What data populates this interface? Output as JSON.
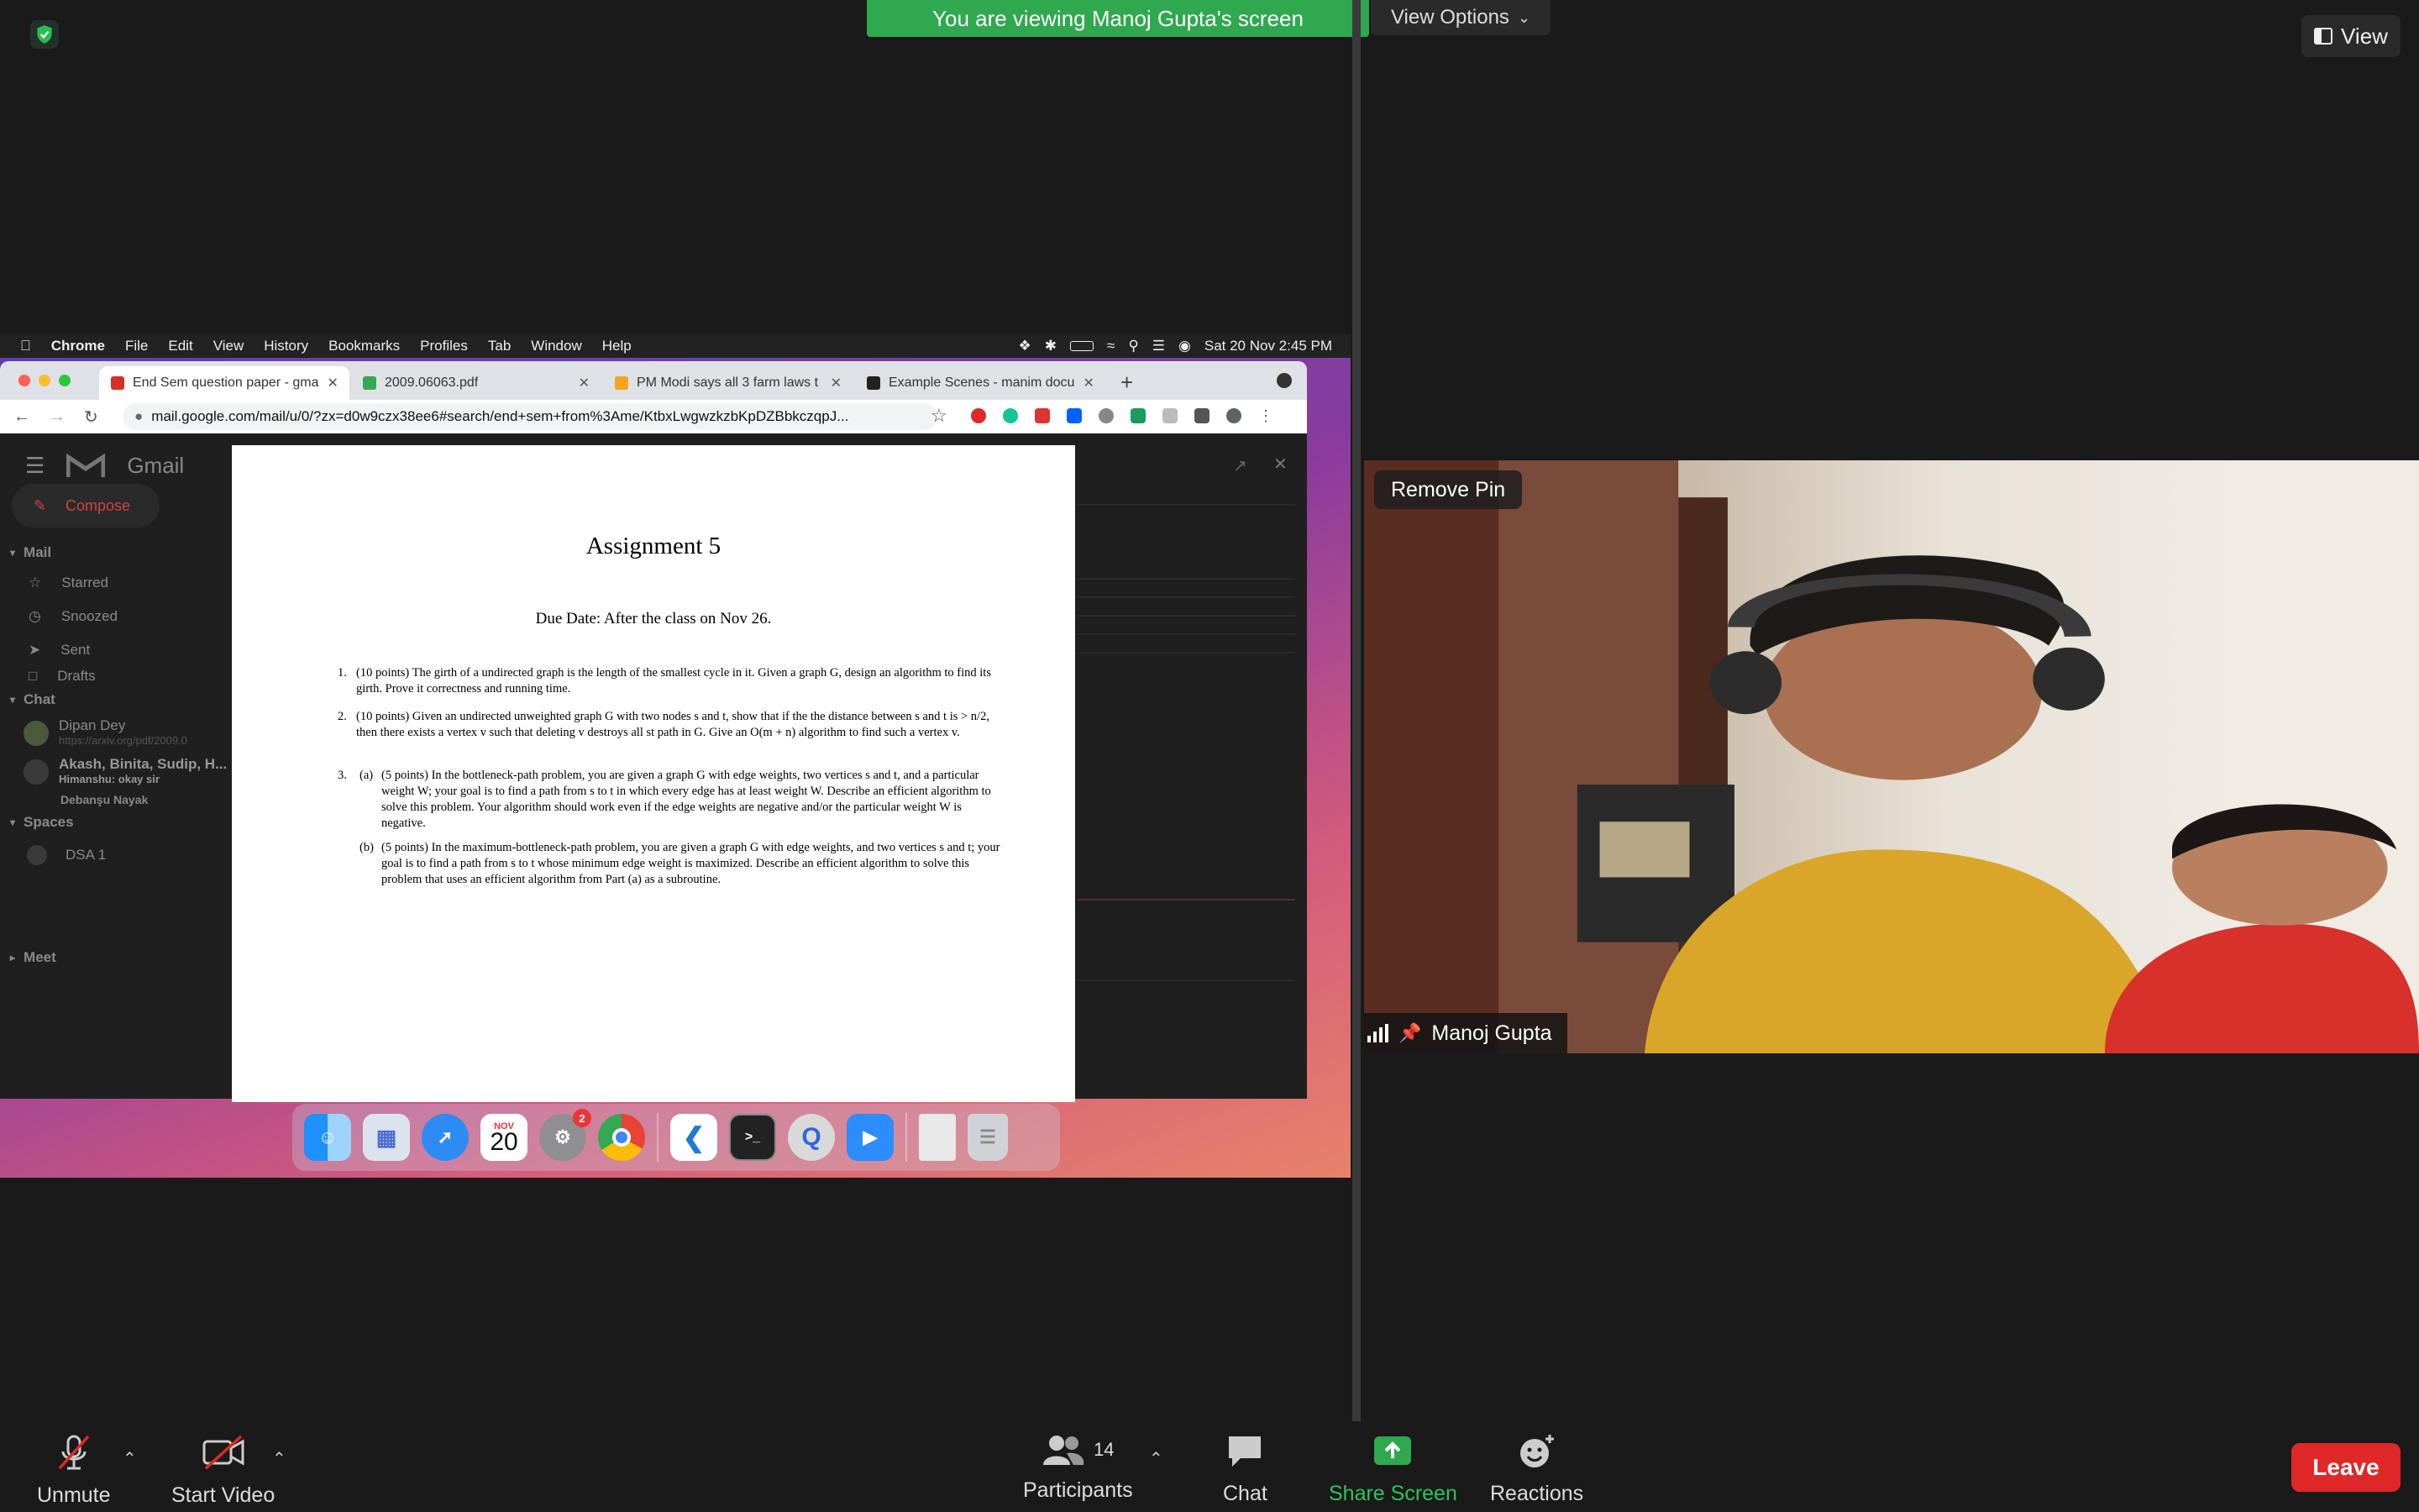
{
  "banner": {
    "text": "You are viewing Manoj Gupta's screen",
    "view_options": "View Options"
  },
  "view_button": "View",
  "mac_menu": {
    "app": "Chrome",
    "items": [
      "File",
      "Edit",
      "View",
      "History",
      "Bookmarks",
      "Profiles",
      "Tab",
      "Window",
      "Help"
    ],
    "datetime": "Sat 20 Nov  2:45 PM"
  },
  "browser": {
    "tabs": [
      {
        "title": "End Sem question paper - gma",
        "favicon_color": "#d93025"
      },
      {
        "title": "2009.06063.pdf",
        "favicon_color": "#34a853"
      },
      {
        "title": "PM Modi says all 3 farm laws t",
        "favicon_color": "#f4a623"
      },
      {
        "title": "Example Scenes - manim docu",
        "favicon_color": "#222222"
      }
    ],
    "url": "mail.google.com/mail/u/0/?zx=d0w9czx38ee6#search/end+sem+from%3Ame/KtbxLwgwzkzbKpDZBbkczqpJ..."
  },
  "gmail": {
    "brand": "Gmail",
    "compose": "Compose",
    "mail_header": "Mail",
    "nav": [
      "Starred",
      "Snoozed",
      "Sent",
      "Drafts"
    ],
    "chat_header": "Chat",
    "chats": [
      {
        "name": "Dipan Dey",
        "preview": "https://arxiv.org/pdf/2009.0"
      },
      {
        "name": "Akash, Binita, Sudip, H...",
        "preview": "Himanshu: okay sir"
      },
      {
        "name": "Debanşu Nayak",
        "preview": ""
      }
    ],
    "spaces_header": "Spaces",
    "spaces": [
      "DSA 1"
    ],
    "meet_header": "Meet"
  },
  "pdf": {
    "title": "Assignment 5",
    "due": "Due Date: After the class on Nov 26.",
    "q1_num": "1.",
    "q1": "(10 points)  The girth of a undirected graph is the length of the smallest cycle in it.  Given a graph G, design an algorithm to find its girth. Prove it correctness and running time.",
    "q2_num": "2.",
    "q2": "(10 points)  Given an undirected unweighted graph G with two nodes s and t, show that if the the distance between s and t is > n/2, then there exists a vertex v such that deleting v destroys all st path in G. Give an O(m + n) algorithm to find such a vertex v.",
    "q3_num": "3.",
    "q3a_label": "(a)",
    "q3a": "(5 points)  In the bottleneck-path problem, you are given a graph G with edge weights, two vertices s and t, and a particular weight W; your goal is to find a path from s to t in which every edge has at least weight W. Describe an efficient algorithm to solve this problem. Your algorithm should work even if the edge weights are negative and/or the particular weight W is negative.",
    "q3b_label": "(b)",
    "q3b": "(5 points)  In the maximum-bottleneck-path problem, you are given a graph G with edge weights, and two vertices s and t; your goal is to find a path from s to t whose minimum edge weight is maximized. Describe an efficient algorithm to solve this problem that uses an efficient algorithm from Part (a) as a subroutine."
  },
  "dock": {
    "calendar_month": "NOV",
    "calendar_day": "20",
    "settings_badge": "2"
  },
  "video": {
    "remove_pin": "Remove Pin",
    "participant_name": "Manoj Gupta"
  },
  "controls": {
    "unmute": "Unmute",
    "start_video": "Start Video",
    "participants": "Participants",
    "participants_count": "14",
    "chat": "Chat",
    "share_screen": "Share Screen",
    "reactions": "Reactions",
    "leave": "Leave"
  },
  "colors": {
    "share_green": "#2fa84f",
    "leave_red": "#e02828",
    "banner_green": "#2fa84f"
  }
}
